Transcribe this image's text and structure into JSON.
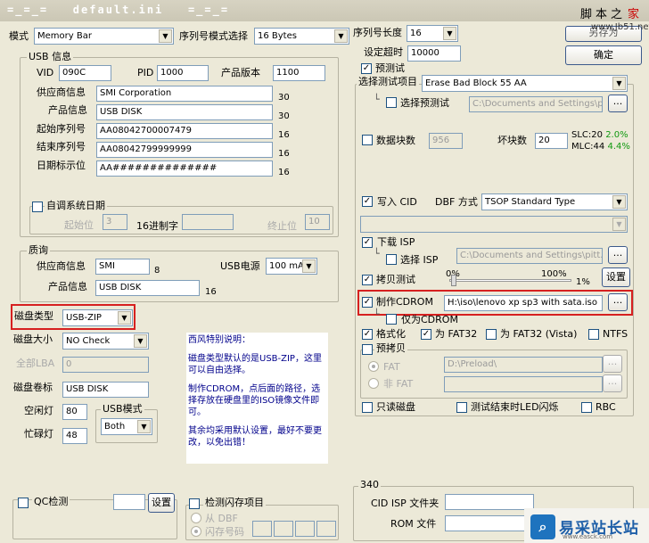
{
  "window": {
    "title": "=_=_=   default.ini   =_=_="
  },
  "watermark": {
    "c1": "脚",
    "c2": "本",
    "c3": "之",
    "c4": "家",
    "url": "www.Jb51.net"
  },
  "top": {
    "mode_label": "模式",
    "mode_value": "Memory Bar",
    "serial_mode_label": "序列号模式选择",
    "serial_mode_value": "16 Bytes",
    "serial_len_label": "序列号长度",
    "serial_len_value": "16",
    "timeout_label": "设定超时",
    "timeout_value": "10000",
    "fix_button": "另存为",
    "ok_button": "确定"
  },
  "usb_info": {
    "title": "USB 信息",
    "vid_label": "VID",
    "vid": "090C",
    "pid_label": "PID",
    "pid": "1000",
    "version_label": "产品版本",
    "version": "1100",
    "vendor_label": "供应商信息",
    "vendor": "SMI Corporation",
    "vendor_len": "30",
    "product_label": "产品信息",
    "product": "USB DISK",
    "product_len": "30",
    "start_sn_label": "起始序列号",
    "start_sn": "AA08042700007479",
    "start_sn_len": "16",
    "end_sn_label": "结束序列号",
    "end_sn": "AA08042799999999",
    "end_sn_len": "16",
    "date_label": "日期标示位",
    "date": "AA##############",
    "date_len": "16",
    "auto_date_label": "自调系统日期",
    "start_pos_label": "起始位",
    "start_pos": "3",
    "hex_label": "16进制字",
    "end_pos_label": "终止位",
    "end_pos": "10"
  },
  "quality": {
    "title": "质询",
    "vendor_label": "供应商信息",
    "vendor": "SMI",
    "vendor_len": "8",
    "usb_power_label": "USB电源",
    "usb_power": "100 mA",
    "product_label": "产品信息",
    "product": "USB DISK",
    "product_len": "16"
  },
  "disk": {
    "type_label": "磁盘类型",
    "type_value": "USB-ZIP",
    "size_label": "磁盘大小",
    "size_value": "NO Check",
    "lba_label": "全部LBA",
    "lba_value": "0",
    "volume_label": "磁盘卷标",
    "volume_value": "USB DISK",
    "idle_led_label": "空闲灯",
    "idle_led": "80",
    "busy_led_label": "忙碌灯",
    "busy_led": "48",
    "usb_mode_title": "USB模式",
    "usb_mode_value": "Both"
  },
  "note": {
    "title": "西风特别说明：",
    "p1": "磁盘类型默认的是USB-ZIP，这里可以自由选择。",
    "p2": "制作CDROM，点后面的路径，选择存放在硬盘里的ISO镜像文件即可。",
    "p3": "其余均采用默认设置，最好不要更改，以免出错！"
  },
  "test": {
    "pretest_label": "预测试",
    "select_item_label": "选择测试项目",
    "select_item_value": "Erase Bad Block 55 AA",
    "select_pretest_label": "选择预测试",
    "pretest_path": "C:\\Documents and Settings\\pit",
    "browse": "...",
    "blocks_label": "数据块数",
    "blocks_value": "956",
    "bad_blocks_label": "坏块数",
    "bad_blocks_value": "20",
    "slc_label": "SLC:20",
    "slc_pct": "2.0%",
    "mlc_label": "MLC:44",
    "mlc_pct": "4.4%",
    "write_cid_label": "写入 CID",
    "dbf_label": "DBF 方式",
    "dbf_value": "TSOP Standard Type",
    "download_isp_label": "下载 ISP",
    "select_isp_label": "选择 ISP",
    "isp_path": "C:\\Documents and Settings\\pitt.ch",
    "copy_test_label": "拷贝测试",
    "pct_left": "0%",
    "pct_right": "100%",
    "pct_value": "1%",
    "settings_button": "设置",
    "make_cdrom_label": "制作CDROM",
    "cdrom_path": "H:\\iso\\lenovo xp sp3 with sata.iso",
    "cdrom_only_label": "仅为CDROM",
    "format_label": "格式化",
    "fat32_label": "为 FAT32",
    "fat32_vista_label": "为 FAT32 (Vista)",
    "ntfs_label": "NTFS",
    "precopy_label": "预拷贝",
    "fat_label": "FAT",
    "fat_path": "D:\\Preload\\",
    "nonfat_label": "非 FAT",
    "readonly_label": "只读磁盘",
    "led_flash_label": "测试结束时LED闪烁",
    "rbc_label": "RBC"
  },
  "bottom": {
    "qc_label": "QC检测",
    "qc_settings": "设置",
    "flash_detect_label": "检测闪存项目",
    "from_dbf_label": "从 DBF",
    "flash_id_label": "闪存号码",
    "group340_title": "340",
    "cid_isp_label": "CID ISP 文件夹",
    "rom_label": "ROM 文件"
  },
  "logo": {
    "text": "易采站长站",
    "url": "www.easck.com"
  }
}
